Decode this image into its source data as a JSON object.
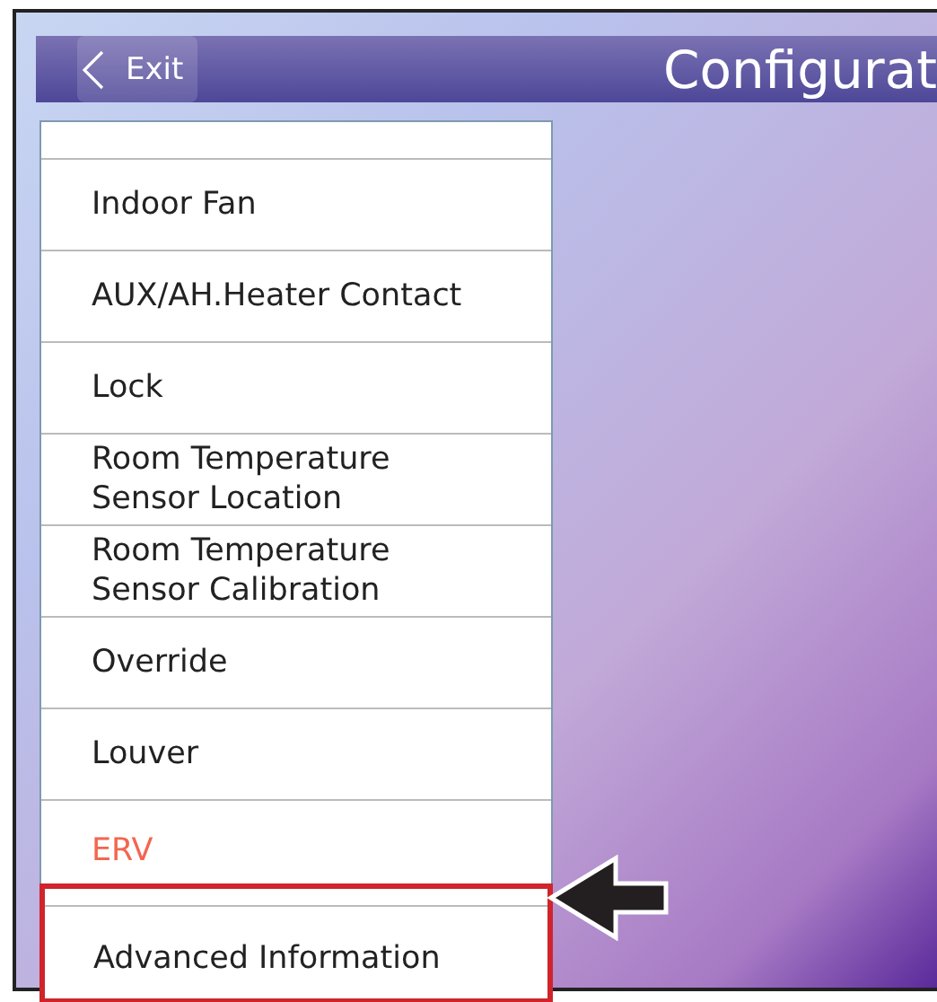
{
  "header": {
    "exit_button": "Exit",
    "title": "Configurat"
  },
  "menu": [
    {
      "label": "Indoor Fan",
      "kind": "normal",
      "callout": false
    },
    {
      "label": "AUX/AH.Heater Contact",
      "kind": "normal",
      "callout": false
    },
    {
      "label": "Lock",
      "kind": "normal",
      "callout": false
    },
    {
      "label": "Room Temperature\nSensor Location",
      "kind": "normal",
      "callout": false
    },
    {
      "label": "Room Temperature\nSensor Calibration",
      "kind": "normal",
      "callout": false
    },
    {
      "label": "Override",
      "kind": "normal",
      "callout": false
    },
    {
      "label": "Louver",
      "kind": "normal",
      "callout": false
    },
    {
      "label": "ERV",
      "kind": "alert",
      "callout": false
    },
    {
      "label": "Advanced Information",
      "kind": "normal",
      "callout": true
    }
  ]
}
